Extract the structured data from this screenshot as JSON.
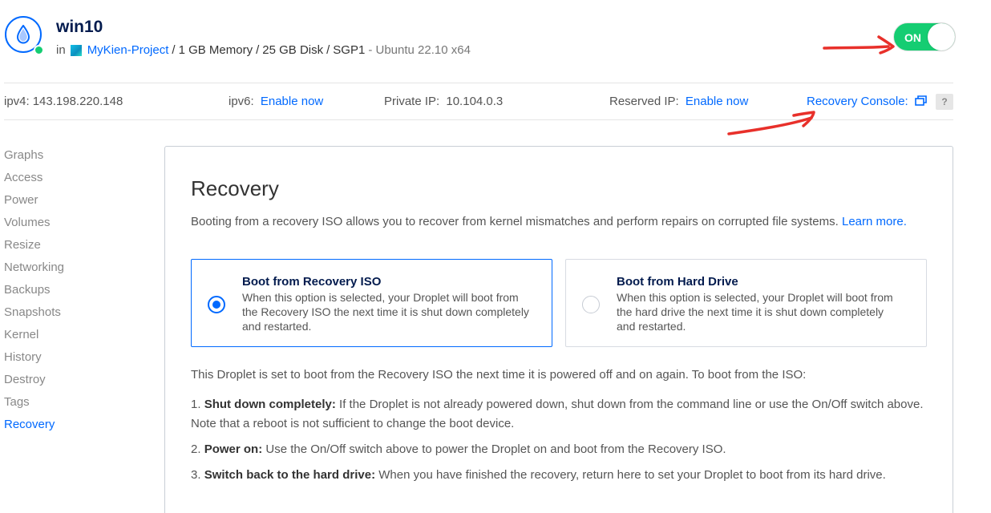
{
  "droplet": {
    "name": "win10",
    "in_label": "in",
    "project": "MyKien-Project",
    "specs": [
      "1 GB Memory",
      "25 GB Disk",
      "SGP1"
    ],
    "os": "- Ubuntu 22.10 x64",
    "power_toggle": "ON",
    "status_color": "#15cd72"
  },
  "infobar": {
    "ipv4_label": "ipv4:",
    "ipv4_value": "143.198.220.148",
    "ipv6_label": "ipv6:",
    "ipv6_action": "Enable now",
    "private_ip_label": "Private IP:",
    "private_ip_value": "10.104.0.3",
    "reserved_ip_label": "Reserved IP:",
    "reserved_ip_action": "Enable now",
    "recovery_console_label": "Recovery Console:",
    "help_label": "?"
  },
  "sidebar": {
    "items": [
      {
        "label": "Graphs"
      },
      {
        "label": "Access"
      },
      {
        "label": "Power"
      },
      {
        "label": "Volumes"
      },
      {
        "label": "Resize"
      },
      {
        "label": "Networking"
      },
      {
        "label": "Backups"
      },
      {
        "label": "Snapshots"
      },
      {
        "label": "Kernel"
      },
      {
        "label": "History"
      },
      {
        "label": "Destroy"
      },
      {
        "label": "Tags"
      },
      {
        "label": "Recovery"
      }
    ],
    "active": "Recovery"
  },
  "recovery": {
    "title": "Recovery",
    "intro_text": "Booting from a recovery ISO allows you to recover from kernel mismatches and perform repairs on corrupted file systems.",
    "learn_more": "Learn more.",
    "options": [
      {
        "title": "Boot from Recovery ISO",
        "description": "When this option is selected, your Droplet will boot from the Recovery ISO the next time it is shut down completely and restarted.",
        "selected": true
      },
      {
        "title": "Boot from Hard Drive",
        "description": "When this option is selected, your Droplet will boot from the hard drive the next time it is shut down completely and restarted.",
        "selected": false
      }
    ],
    "note": "This Droplet is set to boot from the Recovery ISO the next time it is powered off and on again. To boot from the ISO:",
    "steps": [
      {
        "number": "1.",
        "title": "Shut down completely:",
        "text": "If the Droplet is not already powered down, shut down from the command line or use the On/Off switch above. Note that a reboot is not sufficient to change the boot device."
      },
      {
        "number": "2.",
        "title": "Power on:",
        "text": "Use the On/Off switch above to power the Droplet on and boot from the Recovery ISO."
      },
      {
        "number": "3.",
        "title": "Switch back to the hard drive:",
        "text": "When you have finished the recovery, return here to set your Droplet to boot from its hard drive."
      }
    ]
  },
  "colors": {
    "accent": "#0069ff",
    "on_green": "#15cd72",
    "annotation_red": "#e8302a"
  }
}
